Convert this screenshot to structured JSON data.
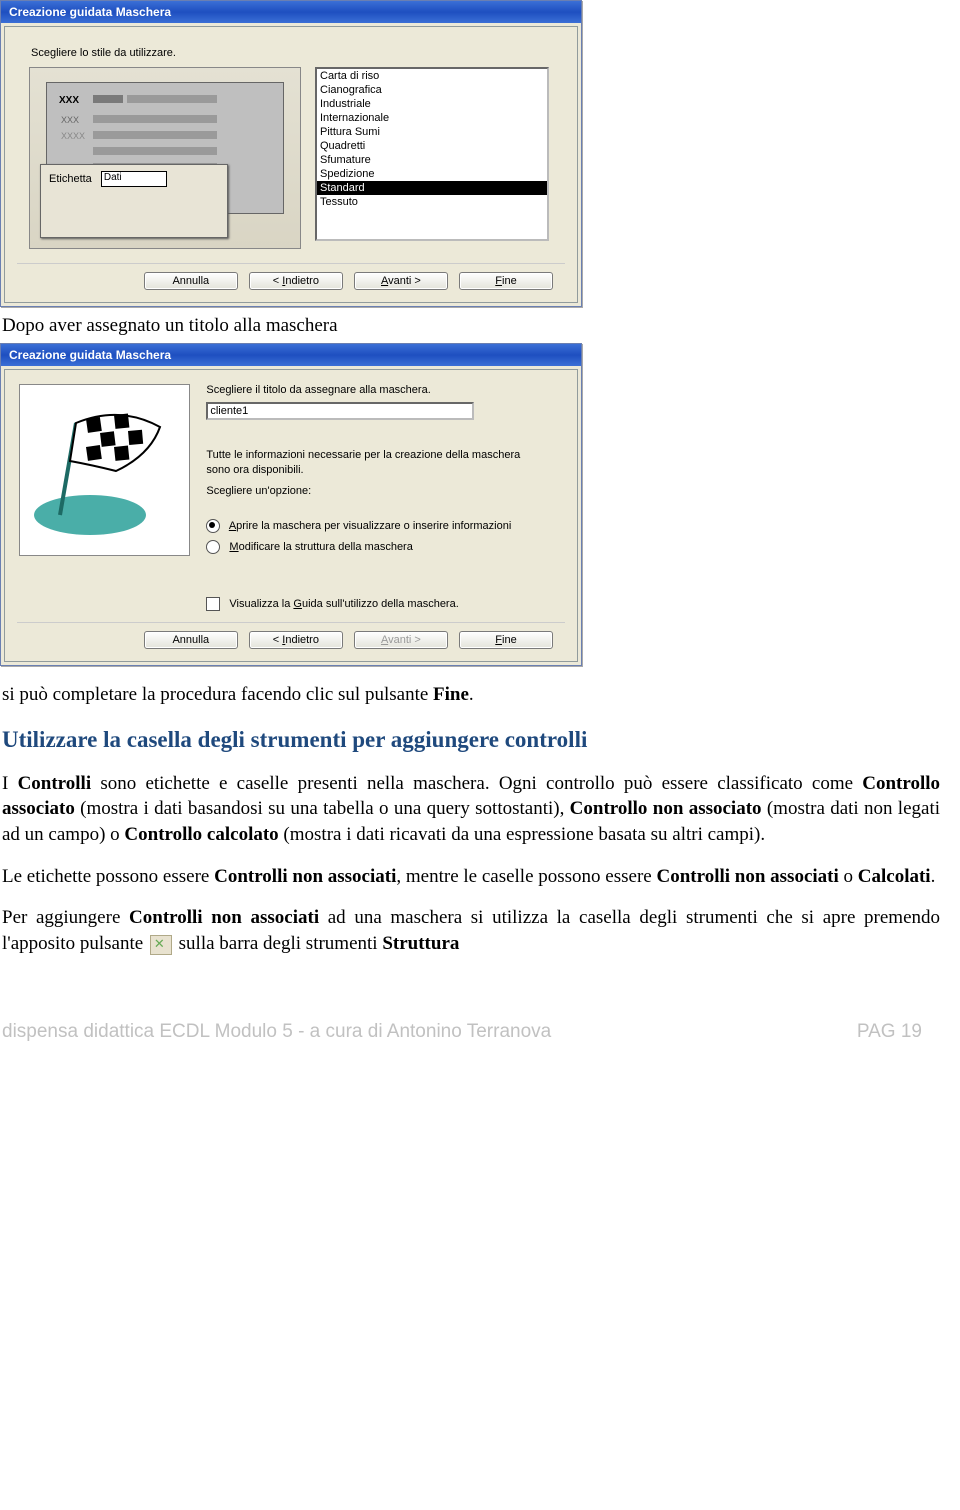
{
  "dialog1": {
    "title": "Creazione guidata Maschera",
    "instr": "Scegliere lo stile da utilizzare.",
    "preview": {
      "xxx": "XXX",
      "etichetta": "Etichetta",
      "dati": "Dati"
    },
    "styles": [
      "Carta di riso",
      "Cianografica",
      "Industriale",
      "Internazionale",
      "Pittura Sumi",
      "Quadretti",
      "Sfumature",
      "Spedizione",
      "Standard",
      "Tessuto"
    ],
    "selected": "Standard",
    "buttons": {
      "cancel": "Annulla",
      "back": "< Indietro",
      "next": "Avanti >",
      "finish": "Fine"
    }
  },
  "caption1": "Dopo aver assegnato un titolo alla maschera",
  "dialog2": {
    "title": "Creazione guidata Maschera",
    "instr": "Scegliere il titolo da assegnare alla maschera.",
    "titleval": "cliente1",
    "ready": "Tutte le informazioni necessarie per la creazione della maschera sono ora disponibili.",
    "choose": "Scegliere un'opzione:",
    "opt1": "Aprire la maschera per visualizzare o inserire informazioni",
    "opt2": "Modificare la struttura della maschera",
    "help": "Visualizza la Guida sull'utilizzo della maschera.",
    "buttons": {
      "cancel": "Annulla",
      "back": "< Indietro",
      "next": "Avanti >",
      "finish": "Fine"
    }
  },
  "body": {
    "p1a": "si può completare la procedura facendo clic sul pulsante ",
    "p1b": "Fine",
    "p1c": ".",
    "h1": "Utilizzare la casella degli strumenti per aggiungere controlli",
    "p2a": "I ",
    "p2b": "Controlli",
    "p2c": " sono etichette e caselle presenti nella maschera.",
    "p3a": "Ogni controllo può essere classificato come ",
    "p3b": "Controllo associato",
    "p3c": " (mostra i dati basandosi su una tabella o una query sottostanti), ",
    "p3d": "Controllo non associato",
    "p3e": " (mostra dati non legati ad un campo) o ",
    "p3f": "Controllo calcolato",
    "p3g": " (mostra i dati ricavati da una espressione basata su altri campi).",
    "p4a": "Le etichette possono essere ",
    "p4b": "Controlli non associati",
    "p4c": ", mentre le caselle possono essere ",
    "p4d": "Controlli non associati",
    "p4e": " o ",
    "p4f": "Calcolati",
    "p4g": ".",
    "p5a": "Per aggiungere ",
    "p5b": "Controlli non associati",
    "p5c": " ad una maschera si utilizza la casella degli strumenti che si apre premendo l'apposito pulsante ",
    "p5d": " sulla barra degli strumenti ",
    "p5e": "Struttura"
  },
  "footer": {
    "left": "dispensa didattica ECDL Modulo 5 - a cura di Antonino Terranova",
    "right": "PAG 19"
  }
}
